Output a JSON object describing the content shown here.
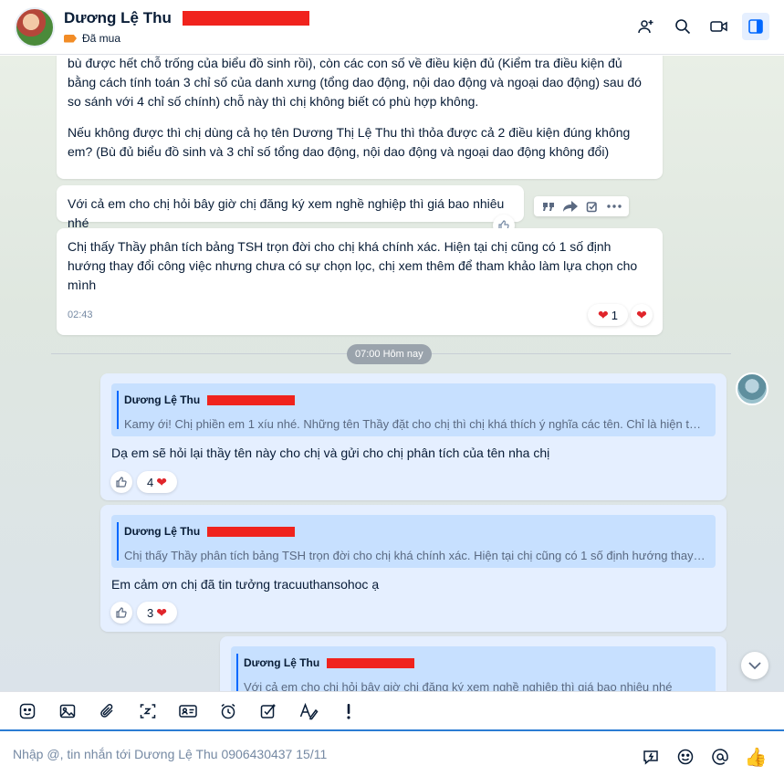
{
  "header": {
    "name": "Dương Lệ Thu",
    "tag": "Đã mua",
    "actions": [
      "add-member-icon",
      "search-icon",
      "video-call-icon",
      "sidebar-toggle-icon"
    ]
  },
  "messages": {
    "m1": {
      "p1": "bù được hết chỗ trống của biểu đồ sinh rồi), còn các con số về điều kiện đủ (Kiểm tra điều kiện đủ bằng cách tính toán 3 chỉ số của danh xưng (tổng dao động, nội dao động và ngoại dao động) sau đó so sánh với 4 chỉ số chính) chỗ này thì chị không biết có phù hợp không.",
      "p2": "Nếu không được thì chị dùng cả họ tên Dương Thị Lệ Thu thì thỏa được cả 2 điều kiện đúng không em? (Bù đủ biểu đồ sinh và 3 chỉ số tổng dao động, nội dao động và ngoại dao động không đổi)"
    },
    "m2": {
      "text": "Với cả em cho chị hỏi bây giờ chị đăng ký xem nghề nghiệp thì giá bao nhiêu nhé"
    },
    "m3": {
      "text": "Chị thấy Thầy phân tích bảng TSH trọn đời cho chị khá chính xác. Hiện tại chị cũng có 1 số định hướng thay đổi công việc nhưng chưa có sự chọn lọc, chị xem thêm để tham khảo làm lựa chọn cho mình",
      "time": "02:43",
      "reaction_count": "1"
    },
    "divider": "07:00 Hôm nay",
    "r1": {
      "quote_name": "Dương Lệ Thu",
      "quote_text": "Kamy ới! Chị phiền em 1 xíu nhé. Những tên Thầy đặt cho chị thì chị khá thích ý nghĩa các tên. Chỉ là hiện tại chị ...",
      "text": "Dạ em sẽ hỏi lại thầy tên này cho chị và gửi cho chị phân tích của tên nha chị",
      "reaction_count": "4"
    },
    "r2": {
      "quote_name": "Dương Lệ Thu",
      "quote_text": "Chị thấy Thầy phân tích bảng TSH trọn đời cho chị khá chính xác. Hiện tại chị cũng có 1 số định hướng thay đổi ...",
      "text": "Em cảm ơn chị đã tin tưởng tracuuthansohoc ạ",
      "reaction_count": "3"
    },
    "r3": {
      "quote_name": "Dương Lệ Thu",
      "quote_text": "Với cả em cho chị hỏi bây giờ chị đăng ký xem nghề nghiệp thì giá bao nhiêu nhé"
    }
  },
  "composer": {
    "placeholder": "Nhập @, tin nhắn tới Dương Lệ Thu 0906430437 15/11",
    "tools": [
      "sticker-icon",
      "image-icon",
      "attachment-icon",
      "screenshot-icon",
      "contact-card-icon",
      "reminder-icon",
      "todo-icon",
      "format-text-icon",
      "urgent-icon"
    ],
    "quick_reaction": "👍"
  },
  "colors": {
    "accent": "#0068ff",
    "redaction": "#f0231d",
    "my_bubble": "#e5efff",
    "heart": "#e0252b"
  }
}
